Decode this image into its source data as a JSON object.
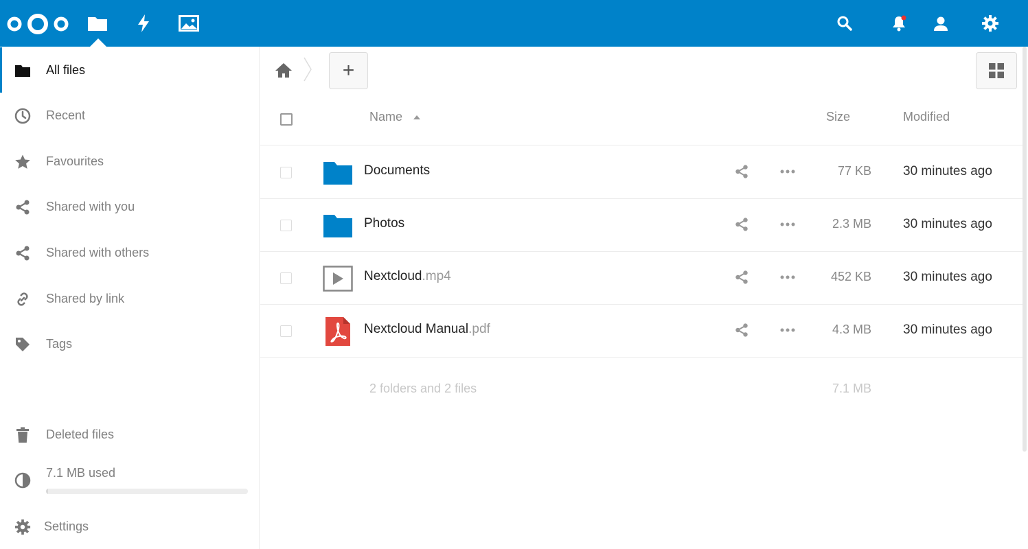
{
  "header": {
    "logo": "nextcloud-logo",
    "apps": [
      {
        "name": "files",
        "icon": "folder-icon",
        "active": true
      },
      {
        "name": "activity",
        "icon": "lightning-icon",
        "active": false
      },
      {
        "name": "gallery",
        "icon": "image-icon",
        "active": false
      }
    ],
    "right_icons": [
      "search-icon",
      "notifications-bell-icon",
      "contacts-icon",
      "settings-gear-icon"
    ],
    "brand_color": "#0082c9"
  },
  "sidebar": {
    "items": [
      {
        "label": "All files",
        "icon": "folder-icon",
        "active": true
      },
      {
        "label": "Recent",
        "icon": "clock-icon"
      },
      {
        "label": "Favourites",
        "icon": "star-icon"
      },
      {
        "label": "Shared with you",
        "icon": "share-icon"
      },
      {
        "label": "Shared with others",
        "icon": "share-icon"
      },
      {
        "label": "Shared by link",
        "icon": "link-icon"
      },
      {
        "label": "Tags",
        "icon": "tag-icon"
      }
    ],
    "deleted_files": "Deleted files",
    "quota": "7.1 MB used",
    "settings": "Settings"
  },
  "toolbar": {
    "new_label": "+"
  },
  "table": {
    "headers": {
      "name": "Name",
      "size": "Size",
      "modified": "Modified"
    },
    "rows": [
      {
        "base": "Documents",
        "ext": "",
        "type": "folder",
        "size": "77 KB",
        "modified": "30 minutes ago"
      },
      {
        "base": "Photos",
        "ext": "",
        "type": "folder",
        "size": "2.3 MB",
        "modified": "30 minutes ago"
      },
      {
        "base": "Nextcloud",
        "ext": ".mp4",
        "type": "video",
        "size": "452 KB",
        "modified": "30 minutes ago"
      },
      {
        "base": "Nextcloud Manual",
        "ext": ".pdf",
        "type": "pdf",
        "size": "4.3 MB",
        "modified": "30 minutes ago"
      }
    ],
    "summary": "2 folders and 2 files",
    "summary_size": "7.1 MB"
  }
}
